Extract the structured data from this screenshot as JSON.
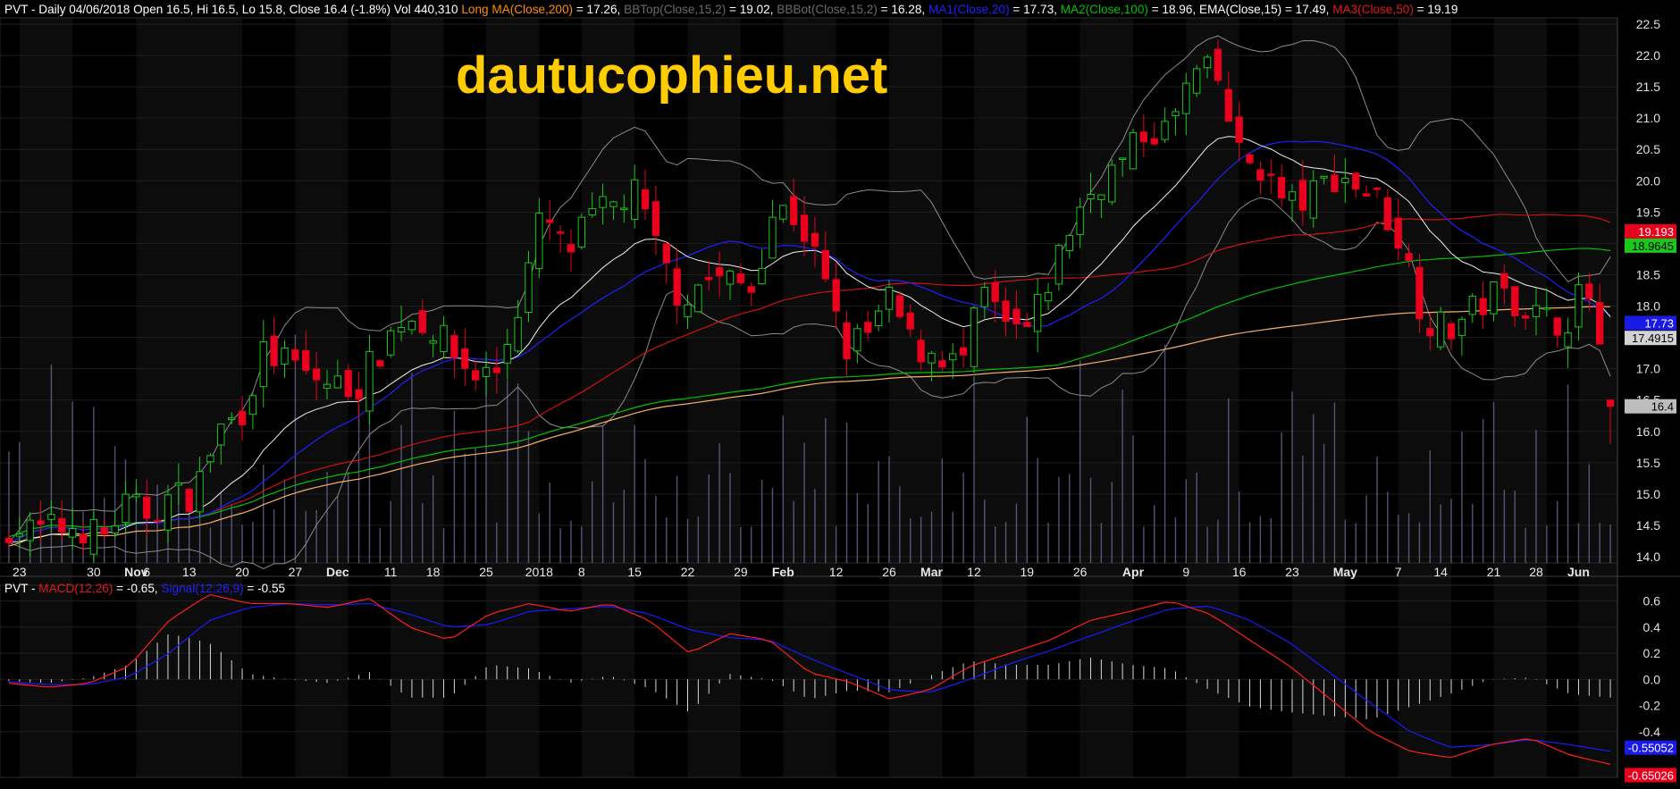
{
  "header": {
    "symbol": "PVT",
    "main_prefix": " - Daily 04/06/2018 Open 16.5, Hi 16.5, Lo 15.8, Close 16.4 (-1.8%) Vol 440,310 ",
    "long_ma_label": "Long MA(Close,200)",
    "long_ma_value": " = 17.26, ",
    "bbtop_label": "BBTop(Close,15,2)",
    "bbtop_value": " = 19.02, ",
    "bbbot_label": "BBBot(Close,15,2)",
    "bbbot_value": " = 16.28, ",
    "ma1_label": "MA1(Close,20)",
    "ma1_value": " = 17.73, ",
    "ma2_label": "MA2(Close,100)",
    "ma2_value": " = 18.96, ",
    "ema_text": "EMA(Close,15) = 17.49, ",
    "ma3_label": "MA3(Close,50)",
    "ma3_value": " = 19.19",
    "macd_prefix": " - ",
    "macd_label": "MACD(12,26)",
    "macd_value": " = -0.65, ",
    "signal_label": "Signal(12,26,9)",
    "signal_value": " = -0.55"
  },
  "watermark": "dautucophieu.net",
  "price_tags": [
    {
      "text": "19.193",
      "value": 19.193,
      "bg": "#e8001c",
      "fg": "#ffffff"
    },
    {
      "text": "18.9645",
      "value": 18.9645,
      "bg": "#19c819",
      "fg": "#000000"
    },
    {
      "text": "17.73",
      "value": 17.73,
      "bg": "#1a1ae6",
      "fg": "#ffffff"
    },
    {
      "text": "17.4915",
      "value": 17.4915,
      "bg": "#d2d2d2",
      "fg": "#000000"
    },
    {
      "text": "16.4",
      "value": 16.4,
      "bg": "#bdbdbd",
      "fg": "#000000"
    }
  ],
  "macd_tags": [
    {
      "text": "-0.55052",
      "value": -0.55,
      "bg": "#1a1ae6",
      "fg": "#ffffff"
    },
    {
      "text": "-0.65026",
      "value": -0.65,
      "bg": "#e8001c",
      "fg": "#ffffff"
    }
  ],
  "colors": {
    "up": "#18c818",
    "down": "#e8001c",
    "ma1": "#2020ff",
    "ma2": "#00c000",
    "ma3": "#d01010",
    "ema": "#f0f0f0",
    "long_ma": "#f5b06a",
    "bb": "#8c8c8c",
    "volume": "#6e6e9e",
    "macd": "#ff1e1e",
    "signal": "#1a1aff",
    "hist": "#d8d8d8",
    "label_orange": "#ff8c00",
    "label_dim": "#6a6a6a",
    "label_blue": "#2020ff",
    "label_green": "#00c000",
    "label_red": "#e01a1a",
    "watermark": "#ffcc00"
  },
  "chart_data": [
    {
      "type": "candlestick",
      "title": "PVT - Daily 04/06/2018",
      "ylim": [
        13.9,
        22.6
      ],
      "y_ticks": [
        "14.0",
        "14.5",
        "15.0",
        "15.5",
        "16.0",
        "16.5",
        "17.0",
        "17.5",
        "18.0",
        "18.5",
        "19.0",
        "19.5",
        "20.0",
        "20.5",
        "21.0",
        "21.5",
        "22.0",
        "22.5"
      ],
      "x_labels": [
        "23",
        "30",
        "Nov",
        "6",
        "13",
        "20",
        "27",
        "Dec",
        "11",
        "18",
        "25",
        "2018",
        "8",
        "15",
        "22",
        "29",
        "Feb",
        "12",
        "26",
        "Mar",
        "12",
        "19",
        "26",
        "Apr",
        "9",
        "16",
        "23",
        "May",
        "7",
        "14",
        "21",
        "28",
        "Jun"
      ],
      "grid": true,
      "series": [
        {
          "name": "Long MA(Close,200)",
          "last": 17.26
        },
        {
          "name": "BBTop(Close,15,2)",
          "last": 19.02
        },
        {
          "name": "BBBot(Close,15,2)",
          "last": 16.28
        },
        {
          "name": "MA1(Close,20)",
          "last": 17.73
        },
        {
          "name": "MA2(Close,100)",
          "last": 18.96
        },
        {
          "name": "EMA(Close,15)",
          "last": 17.49
        },
        {
          "name": "MA3(Close,50)",
          "last": 19.19
        }
      ],
      "anchors": [
        [
          14.5,
          14.4
        ],
        [
          14.45,
          14.5
        ],
        [
          14.3,
          14.8
        ],
        [
          14.7,
          14.95
        ],
        [
          15.0,
          16.0
        ],
        [
          16.3,
          17.25
        ],
        [
          17.1,
          16.85
        ],
        [
          16.75,
          16.7
        ],
        [
          17.3,
          17.85
        ],
        [
          17.75,
          17.3
        ],
        [
          16.9,
          16.95
        ],
        [
          18.05,
          19.5
        ],
        [
          18.8,
          19.35
        ],
        [
          19.6,
          19.8
        ],
        [
          18.8,
          18.1
        ],
        [
          18.45,
          18.4
        ],
        [
          18.3,
          19.6
        ],
        [
          19.4,
          18.55
        ],
        [
          17.3,
          17.55
        ],
        [
          18.1,
          17.3
        ],
        [
          17.3,
          17.0
        ],
        [
          18.2,
          17.6
        ],
        [
          17.6,
          18.6
        ],
        [
          19.5,
          20.0
        ],
        [
          20.3,
          20.8
        ],
        [
          20.8,
          21.7
        ],
        [
          21.7,
          20.4
        ],
        [
          20.2,
          19.6
        ],
        [
          19.7,
          20.1
        ],
        [
          19.95,
          19.7
        ],
        [
          19.0,
          17.8
        ],
        [
          17.6,
          17.9
        ],
        [
          18.2,
          18.1
        ],
        [
          17.8,
          17.75
        ],
        [
          18.3,
          16.4
        ]
      ],
      "volume_note": "volume bars drawn as background histogram",
      "last": {
        "open": 16.5,
        "high": 16.5,
        "low": 15.8,
        "close": 16.4,
        "volume": 440310
      }
    },
    {
      "type": "line",
      "title": "PVT - MACD(12,26), Signal(12,26,9)",
      "ylim": [
        -0.75,
        0.72
      ],
      "y_ticks": [
        "0.6",
        "0.4",
        "0.2",
        "0.0",
        "-0.2",
        "-0.4"
      ],
      "series": [
        {
          "name": "MACD(12,26)",
          "last": -0.65
        },
        {
          "name": "Signal(12,26,9)",
          "last": -0.55
        }
      ],
      "macd_anchors": [
        -0.03,
        -0.06,
        -0.03,
        0.1,
        0.45,
        0.65,
        0.58,
        0.58,
        0.55,
        0.62,
        0.4,
        0.3,
        0.5,
        0.58,
        0.52,
        0.58,
        0.45,
        0.2,
        0.35,
        0.3,
        0.05,
        -0.02,
        -0.15,
        -0.08,
        0.1,
        0.2,
        0.3,
        0.45,
        0.52,
        0.6,
        0.5,
        0.3,
        0.1,
        -0.15,
        -0.4,
        -0.55,
        -0.6,
        -0.5,
        -0.45,
        -0.58,
        -0.65
      ],
      "signal_anchors": [
        -0.02,
        -0.04,
        -0.04,
        0.02,
        0.2,
        0.45,
        0.55,
        0.58,
        0.57,
        0.58,
        0.5,
        0.4,
        0.42,
        0.52,
        0.54,
        0.56,
        0.5,
        0.38,
        0.32,
        0.3,
        0.16,
        0.04,
        -0.08,
        -0.1,
        0.0,
        0.12,
        0.22,
        0.33,
        0.44,
        0.54,
        0.56,
        0.45,
        0.28,
        0.05,
        -0.18,
        -0.4,
        -0.52,
        -0.5,
        -0.46,
        -0.5,
        -0.55
      ]
    }
  ]
}
